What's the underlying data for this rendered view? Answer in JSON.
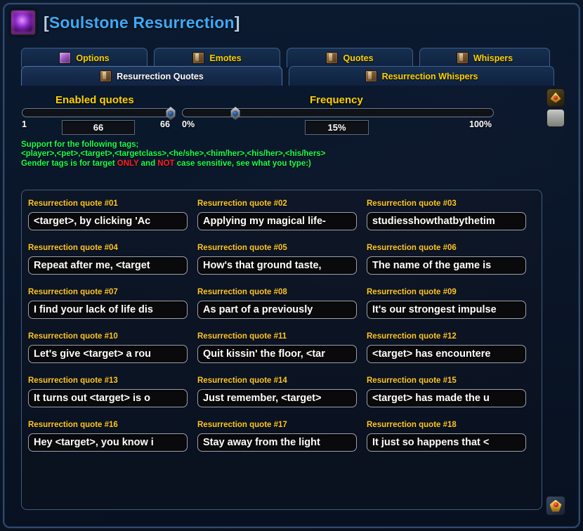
{
  "window": {
    "title_open_bracket": "[",
    "title": "Soulstone Resurrection",
    "title_close_bracket": "]",
    "icon": "soulstone-orb-icon",
    "accent_color": "#3fa9f5",
    "label_color": "#ffd100",
    "help_color": "#1eff4a",
    "warn_color": "#ff1f1f"
  },
  "tabs": {
    "row1": [
      {
        "label": "Options",
        "icon": "magic-icon",
        "active": false
      },
      {
        "label": "Emotes",
        "icon": "book-icon",
        "active": false
      },
      {
        "label": "Quotes",
        "icon": "book-icon",
        "active": false
      },
      {
        "label": "Whispers",
        "icon": "book-icon",
        "active": false
      }
    ],
    "row2": [
      {
        "label": "Resurrection Quotes",
        "icon": "book-icon",
        "active": true
      },
      {
        "label": "Resurrection Whispers",
        "icon": "book-icon",
        "active": false
      }
    ]
  },
  "sliders": {
    "enabled_quotes": {
      "label": "Enabled quotes",
      "min_label": "1",
      "max_label": "66",
      "value": "66",
      "percent": 100
    },
    "frequency": {
      "label": "Frequency",
      "min_label": "0%",
      "max_label": "100%",
      "value": "15%",
      "percent": 17
    }
  },
  "help_text": {
    "line1": "Support for the following tags;",
    "line2": "<player>,<pet>,<target>,<targetclass>,<he/she>,<him/her>,<his/her>,<his/hers>",
    "line3_a": "Gender tags is for target ",
    "line3_only": "ONLY",
    "line3_b": " and ",
    "line3_not": "NOT",
    "line3_c": " case sensitive, see what you type:)"
  },
  "quotes": [
    {
      "label": "Resurrection quote #01",
      "value": "<target>, by clicking 'Ac"
    },
    {
      "label": "Resurrection quote #02",
      "value": "Applying my magical life-"
    },
    {
      "label": "Resurrection quote #03",
      "value": "studiesshowthatbythetim"
    },
    {
      "label": "Resurrection quote #04",
      "value": "Repeat after me, <target"
    },
    {
      "label": "Resurrection quote #05",
      "value": "How's that ground taste,"
    },
    {
      "label": "Resurrection quote #06",
      "value": "The name of the game is"
    },
    {
      "label": "Resurrection quote #07",
      "value": "I find your lack of life dis"
    },
    {
      "label": "Resurrection quote #08",
      "value": "As part of a previously"
    },
    {
      "label": "Resurrection quote #09",
      "value": "It's our strongest impulse"
    },
    {
      "label": "Resurrection quote #10",
      "value": "Let's give <target> a rou"
    },
    {
      "label": "Resurrection quote #11",
      "value": "Quit kissin' the floor, <tar"
    },
    {
      "label": "Resurrection quote #12",
      "value": "<target> has encountere"
    },
    {
      "label": "Resurrection quote #13",
      "value": "It turns out <target> is o"
    },
    {
      "label": "Resurrection quote #14",
      "value": "Just remember, <target>"
    },
    {
      "label": "Resurrection quote #15",
      "value": "<target> has made the u"
    },
    {
      "label": "Resurrection quote #16",
      "value": "Hey <target>, you know i"
    },
    {
      "label": "Resurrection quote #17",
      "value": "Stay away from the light"
    },
    {
      "label": "Resurrection quote #18",
      "value": "It just so happens that <"
    }
  ],
  "side_buttons": [
    {
      "name": "gem-button",
      "icon": "gold-gem-icon"
    },
    {
      "name": "blank-button",
      "icon": "blank-icon"
    }
  ],
  "corner": {
    "name": "resize-grip",
    "icon": "gold-gem-icon"
  }
}
